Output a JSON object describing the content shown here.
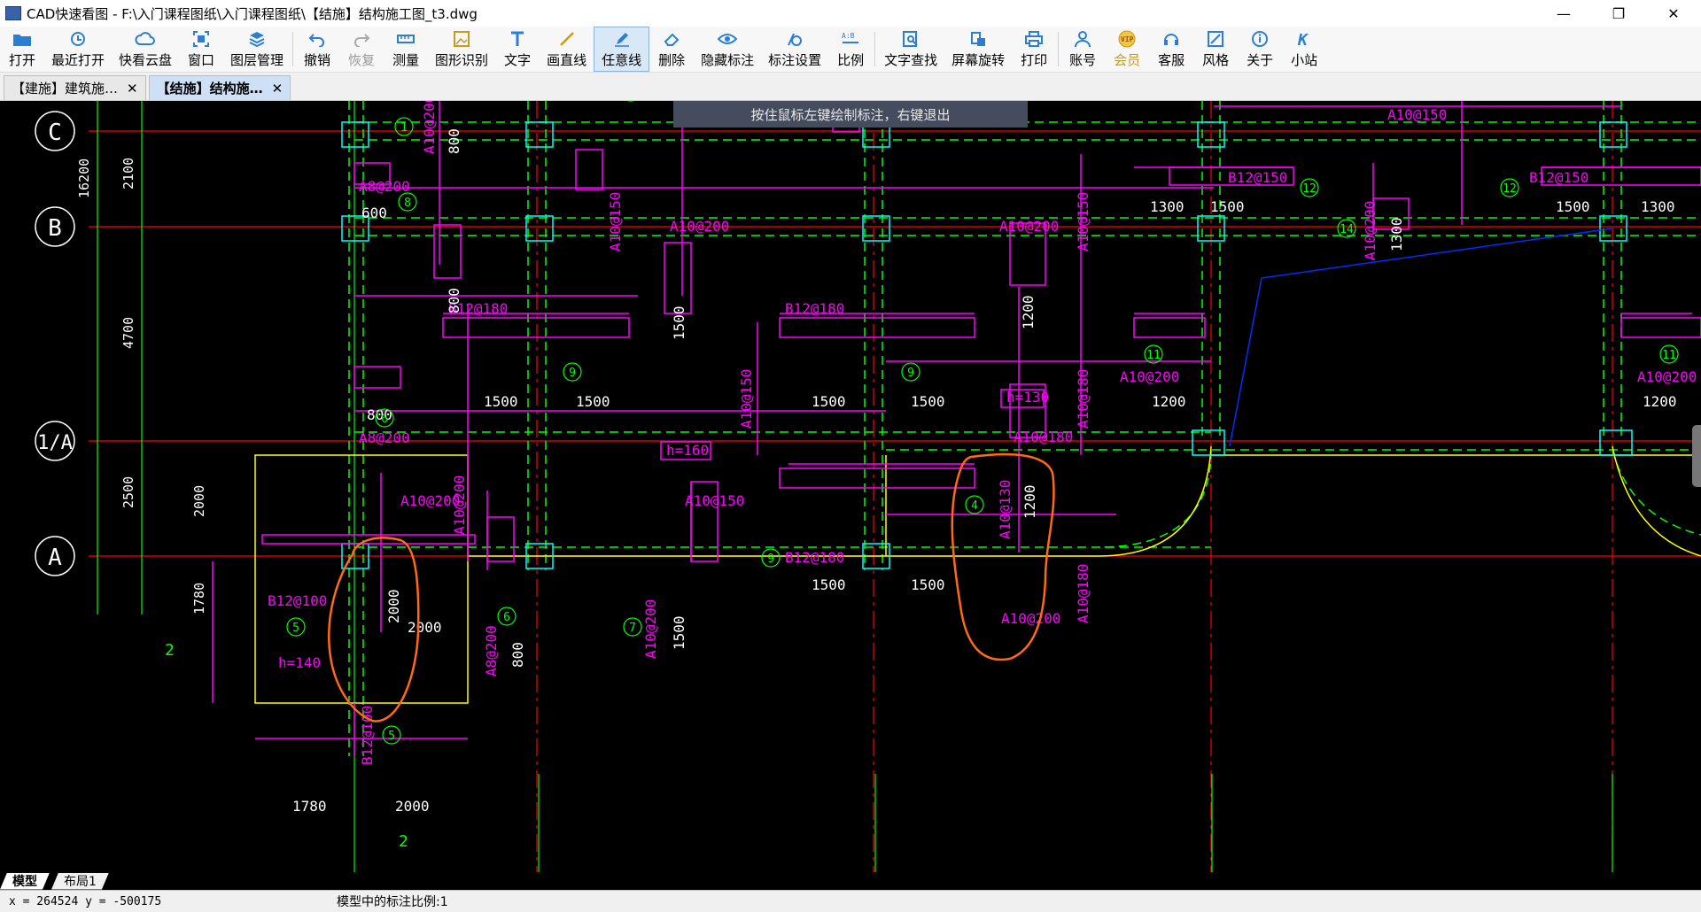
{
  "window": {
    "title": "CAD快速看图 - F:\\入门课程图纸\\入门课程图纸\\【结施】结构施工图_t3.dwg",
    "minimize": "—",
    "maximize": "❐",
    "close": "✕"
  },
  "toolbar": {
    "open": "打开",
    "recent": "最近打开",
    "cloud": "快看云盘",
    "window": "窗口",
    "layers": "图层管理",
    "undo": "撤销",
    "redo": "恢复",
    "measure": "测量",
    "recognize": "图形识别",
    "text": "文字",
    "line": "画直线",
    "freeline": "任意线",
    "delete": "删除",
    "hide_dims": "隐藏标注",
    "dim_settings": "标注设置",
    "scale": "比例",
    "text_search": "文字查找",
    "rotate": "屏幕旋转",
    "print": "打印",
    "account": "账号",
    "vip": "会员",
    "service": "客服",
    "style": "风格",
    "about": "关于",
    "station": "小站"
  },
  "tabs": [
    {
      "label": "【建施】建筑施…",
      "close": "✕"
    },
    {
      "label": "【结施】结构施…",
      "close": "✕"
    }
  ],
  "hint": "按住鼠标左键绘制标注，右键退出",
  "drawing": {
    "axes": [
      "C",
      "B",
      "1/A",
      "A"
    ],
    "dims_left": [
      "16200",
      "2100",
      "4700",
      "2500",
      "2000",
      "1780"
    ],
    "labels": {
      "a8_200": "A8@200",
      "a10_200": "A10@200",
      "a10_150": "A10@150",
      "a10_180": "A10@180",
      "a10_130": "A10@130",
      "b12_180": "B12@180",
      "b12_150": "B12@150",
      "b12_100": "B12@100",
      "h160": "h=160",
      "h130": "h=130",
      "h140": "h=140"
    },
    "nums": [
      "600",
      "800",
      "1500",
      "1200",
      "1300",
      "2000",
      "1780",
      "2"
    ],
    "circles": [
      "1",
      "2",
      "4",
      "5",
      "6",
      "7",
      "8",
      "9",
      "11",
      "12",
      "14"
    ]
  },
  "layout_tabs": [
    "模型",
    "布局1"
  ],
  "status": {
    "coords": "x = 264524  y = -500175",
    "scale": "模型中的标注比例:1"
  },
  "colors": {
    "axis_green": "#00ff00",
    "beam_dashed": "#00ff00",
    "rebar_magenta": "#ff00ff",
    "axis_red": "#ff0000",
    "column_cyan": "#00ffff",
    "annotation_orange": "#ff6a13",
    "slab_yellow": "#ffff00",
    "blue_line": "#0030ff"
  }
}
